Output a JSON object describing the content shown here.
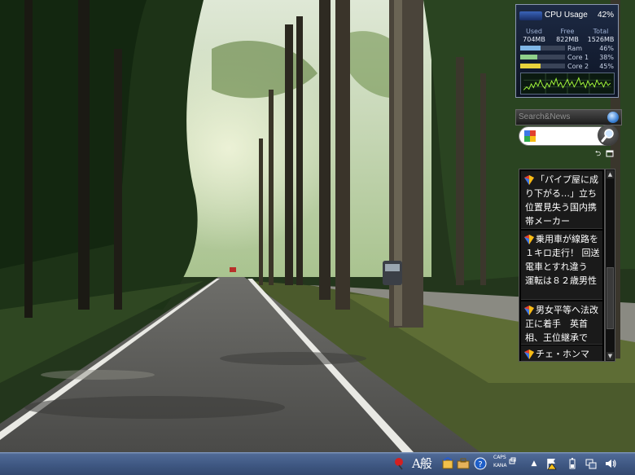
{
  "cpu_gadget": {
    "title": "CPU Usage",
    "percent": "42%",
    "memory": {
      "used_label": "Used",
      "used_value": "704MB",
      "free_label": "Free",
      "free_value": "822MB",
      "total_label": "Total",
      "total_value": "1526MB"
    },
    "bars": [
      {
        "label": "Ram",
        "value": "46%",
        "fraction": 0.46,
        "color": "#7fb6e6"
      },
      {
        "label": "Core 1",
        "value": "38%",
        "fraction": 0.38,
        "color": "#8fd08a"
      },
      {
        "label": "Core 2",
        "value": "45%",
        "fraction": 0.45,
        "color": "#e8d23c"
      }
    ],
    "graph_color": "#a8ff3c"
  },
  "news_gadget": {
    "header_title": "Search&News",
    "search_placeholder": "",
    "items": [
      {
        "text": "「パイプ屋に成り下がる…」立ち位置見失う国内携帯メーカー"
      },
      {
        "text": "乗用車が線路を１キロ走行！ 回送電車とすれ違う　運転は８２歳男性"
      },
      {
        "text": "男女平等へ法改正に着手　英首相、王位継承で"
      },
      {
        "text": "チェ・ホンマ"
      }
    ]
  },
  "taskbar": {
    "ime_mode": "A般",
    "caps": "CAPS",
    "kana": "KANA",
    "colors": {
      "taskbar": "#3f5883"
    }
  }
}
